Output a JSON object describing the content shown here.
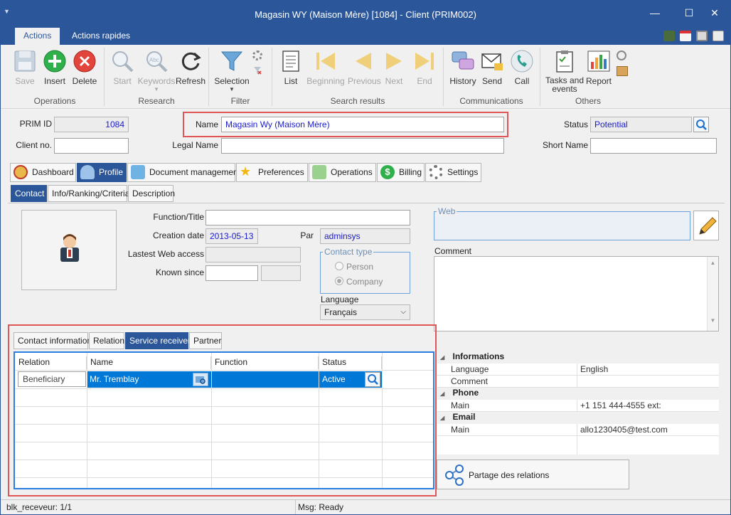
{
  "window": {
    "title": "Magasin WY (Maison Mère) [1084] - Client (PRIM002)",
    "min_glyph": "—",
    "max_glyph": "☐",
    "close_glyph": "✕"
  },
  "ribbon_tabs": [
    "Actions",
    "Actions rapides"
  ],
  "ribbon": {
    "groups": [
      "Operations",
      "Research",
      "Filter",
      "Search results",
      "Communications",
      "Others"
    ],
    "save": "Save",
    "insert": "Insert",
    "delete": "Delete",
    "start": "Start",
    "keywords": "Keywords",
    "refresh": "Refresh",
    "selection": "Selection",
    "list": "List",
    "beginning": "Beginning",
    "previous": "Previous",
    "next": "Next",
    "end": "End",
    "history": "History",
    "send": "Send",
    "call": "Call",
    "tasks": "Tasks and events",
    "report": "Report"
  },
  "header_fields": {
    "prim_id_label": "PRIM ID",
    "prim_id_value": "1084",
    "client_no_label": "Client no.",
    "client_no_value": "",
    "name_label": "Name",
    "name_value": "Magasin Wy (Maison Mère)",
    "legal_name_label": "Legal Name",
    "legal_name_value": "",
    "status_label": "Status",
    "status_value": "Potential",
    "short_name_label": "Short Name",
    "short_name_value": ""
  },
  "main_tabs": [
    "Dashboard",
    "Profile",
    "Document management",
    "Preferences",
    "Operations",
    "Billing",
    "Settings"
  ],
  "sub_tabs": [
    "Contact",
    "Info/Ranking/Criteria",
    "Description"
  ],
  "contact": {
    "function_label": "Function/Title",
    "function_value": "",
    "creation_label": "Creation date",
    "creation_value": "2013-05-13",
    "par_label": "Par",
    "par_value": "adminsys",
    "web_access_label": "Lastest Web access",
    "web_access_value": "",
    "known_label": "Known since",
    "known_value": "",
    "contact_type_label": "Contact type",
    "person_label": "Person",
    "company_label": "Company",
    "language_label": "Language",
    "language_value": "Français",
    "web_label": "Web",
    "comment_label": "Comment"
  },
  "bottom_tabs": [
    "Contact information",
    "Relation",
    "Service receiver",
    "Partner"
  ],
  "grid": {
    "headers": [
      "Relation",
      "Name",
      "Function",
      "Status"
    ],
    "row": {
      "relation": "Beneficiary",
      "name": "Mr. Tremblay",
      "function": "",
      "status": "Active"
    }
  },
  "properties": {
    "informations": "Informations",
    "language_label": "Language",
    "language_value": "English",
    "comment_label": "Comment",
    "comment_value": "",
    "phone": "Phone",
    "main_label": "Main",
    "phone_value": "+1 151 444-4555 ext:",
    "email": "Email",
    "email_main_label": "Main",
    "email_value": "allo1230405@test.com"
  },
  "share_button": "Partage des relations",
  "statusbar": {
    "left": "blk_receveur: 1/1",
    "right": "Msg: Ready"
  },
  "colors": {
    "accent": "#2b579a",
    "highlight": "#e05555",
    "selection": "#0078d7"
  }
}
